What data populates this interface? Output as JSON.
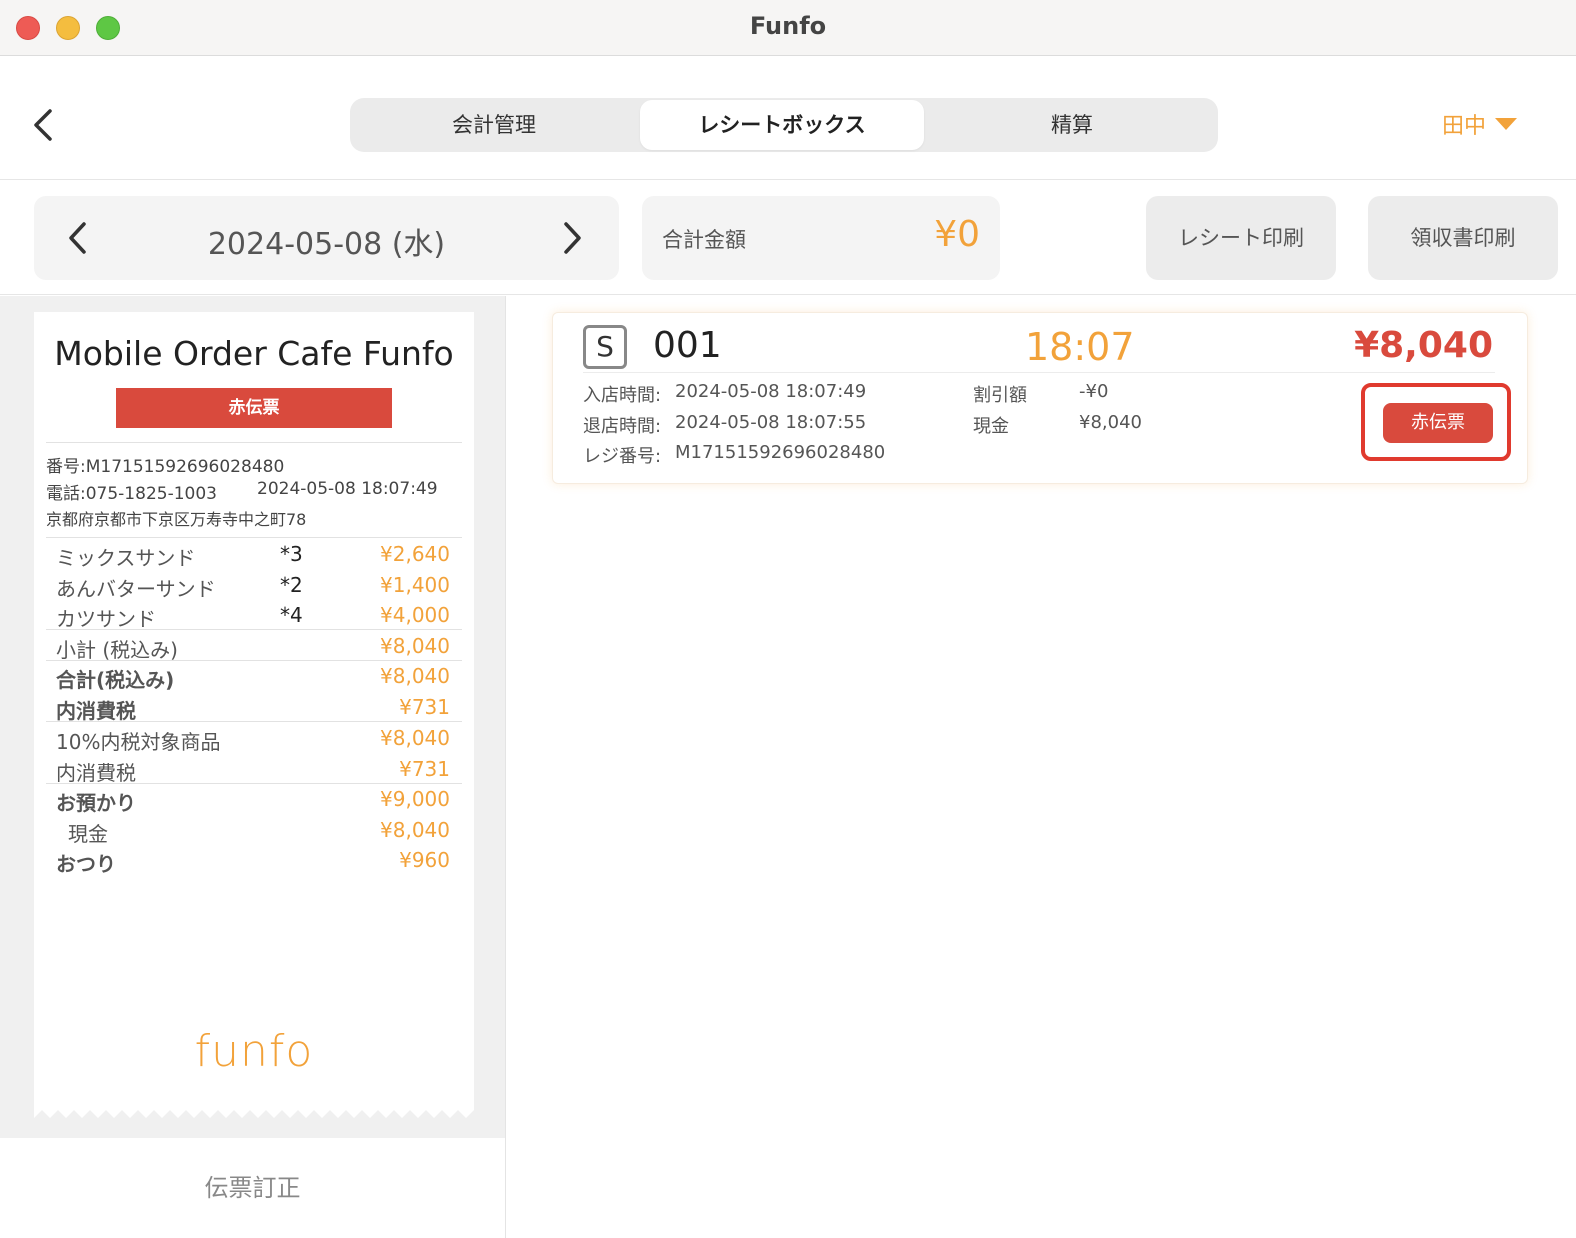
{
  "window": {
    "title": "Funfo"
  },
  "header": {
    "tabs": [
      {
        "label": "会計管理"
      },
      {
        "label": "レシートボックス"
      },
      {
        "label": "精算"
      }
    ],
    "user": "田中"
  },
  "toolbar": {
    "date": "2024-05-08 (水)",
    "total_label": "合計金額",
    "total_value": "¥0",
    "receipt_print": "レシート印刷",
    "invoice_print": "領収書印刷"
  },
  "receipt": {
    "shop_name": "Mobile Order Cafe Funfo",
    "badge": "赤伝票",
    "number": "番号:M17151592696028480",
    "phone": "電話:075-1825-1003",
    "datetime": "2024-05-08 18:07:49",
    "address": "京都府京都市下京区万寿寺中之町78",
    "items": [
      {
        "name": "ミックスサンド",
        "qty": "*3",
        "amount": "¥2,640"
      },
      {
        "name": "あんバターサンド",
        "qty": "*2",
        "amount": "¥1,400"
      },
      {
        "name": "カツサンド",
        "qty": "*4",
        "amount": "¥4,000"
      }
    ],
    "summary": [
      {
        "name": "小計 (税込み)",
        "amount": "¥8,040"
      },
      {
        "name": "合計(税込み)",
        "amount": "¥8,040"
      },
      {
        "name": "内消費税",
        "amount": "¥731"
      },
      {
        "name": "10%内税対象商品",
        "amount": "¥8,040"
      },
      {
        "name": "内消費税",
        "amount": "¥731"
      },
      {
        "name": "お預かり",
        "amount": "¥9,000"
      },
      {
        "name": "現金",
        "amount": "¥8,040"
      },
      {
        "name": "おつり",
        "amount": "¥960"
      }
    ],
    "logo": "funfo"
  },
  "left_footer": {
    "correction": "伝票訂正"
  },
  "order_card": {
    "badge": "S",
    "number": "001",
    "time": "18:07",
    "total": "¥8,040",
    "entry_label": "入店時間:",
    "entry_value": "2024-05-08 18:07:49",
    "exit_label": "退店時間:",
    "exit_value": "2024-05-08 18:07:55",
    "register_label": "レジ番号:",
    "register_value": "M17151592696028480",
    "discount_label": "割引額",
    "discount_value": "-¥0",
    "cash_label": "現金",
    "cash_value": "¥8,040",
    "red_slip_button": "赤伝票"
  },
  "colors": {
    "accent": "#f2a23a",
    "red": "#d94a3d",
    "highlight": "#e03a2e"
  }
}
